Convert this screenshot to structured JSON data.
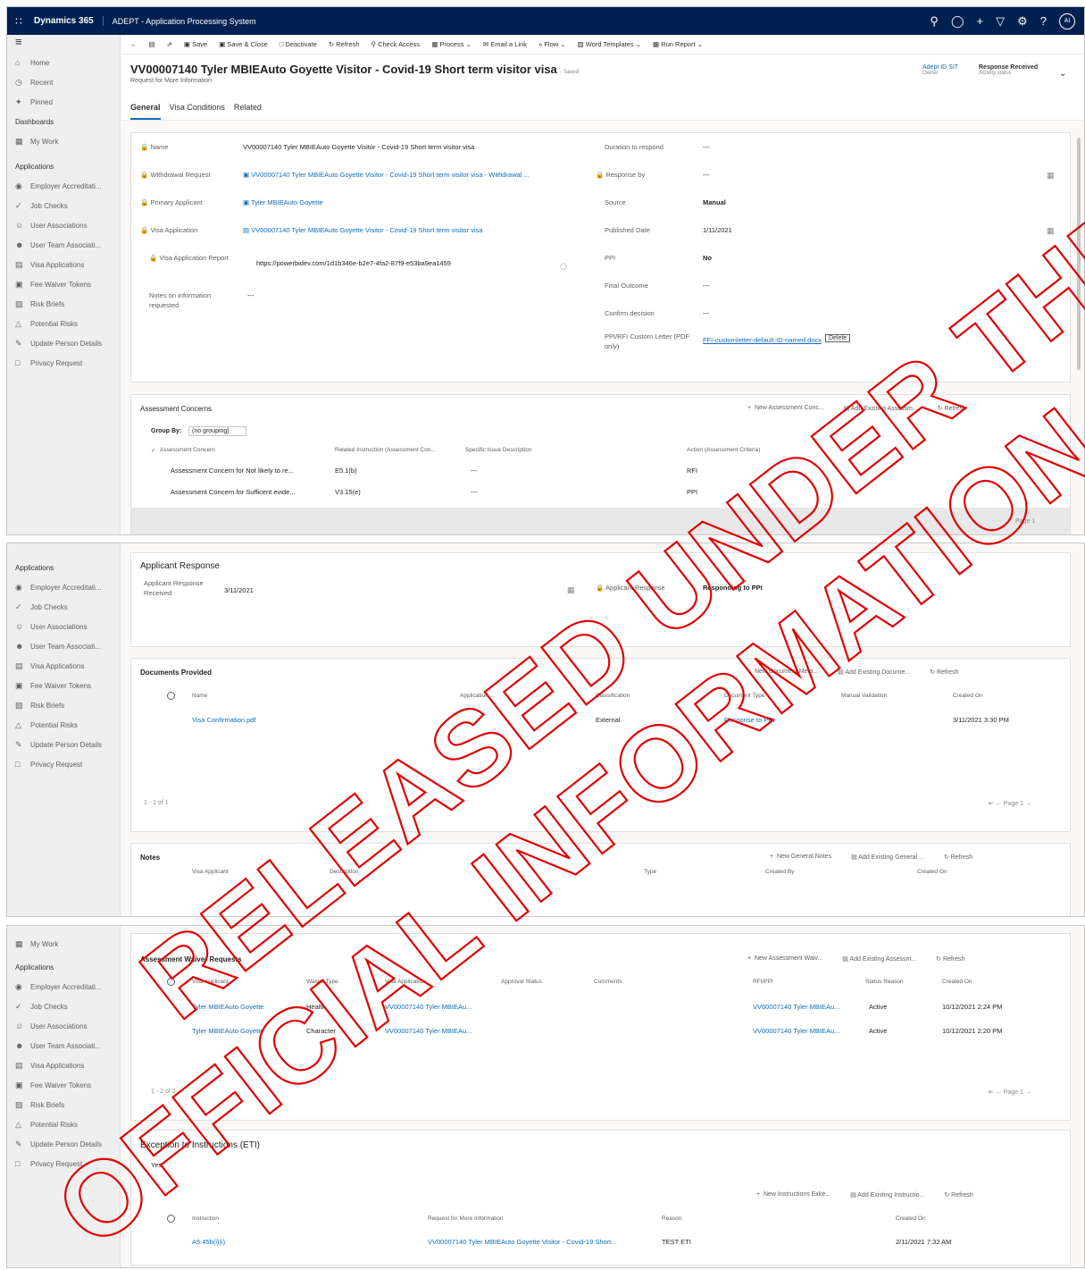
{
  "topbar": {
    "brand": "Dynamics 365",
    "app_title": "ADEPT - Application Processing System",
    "avatar": "AI",
    "icons": [
      "search-icon",
      "lightbulb-icon",
      "plus-icon",
      "filter-icon",
      "gear-icon",
      "help-icon"
    ]
  },
  "sidebar": {
    "home": "Home",
    "recent": "Recent",
    "pinned": "Pinned",
    "dashboards": "Dashboards",
    "my_work": "My Work",
    "applications": "Applications",
    "items": [
      "Employer Accreditati...",
      "Job Checks",
      "User Associations",
      "User Team Associati...",
      "Visa Applications",
      "Fee Waiver Tokens",
      "Risk Briefs",
      "Potential Risks",
      "Update Person Details",
      "Privacy Request"
    ]
  },
  "commands": [
    "Save",
    "Save & Close",
    "Deactivate",
    "Refresh",
    "Check Access",
    "Process",
    "Email a Link",
    "Flow",
    "Word Templates",
    "Run Report"
  ],
  "record": {
    "title": "VV00007140 Tyler MBIEAuto Goyette Visitor - Covid-19 Short term visitor visa",
    "title_suffix": "- Saved",
    "subtitle": "Request for More Information",
    "owner_value": "Adept ID SIT",
    "owner_label": "Owner",
    "status_value": "Response Received",
    "status_label": "Activity status"
  },
  "tabs": [
    "General",
    "Visa Conditions",
    "Related"
  ],
  "fields_left": [
    {
      "label": "Name",
      "value": "VV00007140 Tyler MBIEAuto Goyette Visitor - Covid-19 Short term visitor visa"
    },
    {
      "label": "Withdrawal Request",
      "value": "VV00007140 Tyler MBIEAuto Goyette Visitor - Covid-19 Short term visitor visa - Withdrawal ..."
    },
    {
      "label": "Primary Applicant",
      "value": "Tyler MBIEAuto Goyette"
    },
    {
      "label": "Visa Application",
      "value": "VV00007140 Tyler MBIEAuto Goyette Visitor - Covid-19 Short term visitor visa"
    },
    {
      "label": "Visa Application Report",
      "value": "https://powerbidev.com/1d1b346e-b2e7-4fa2-87f9-e53ba9ea1459"
    },
    {
      "label": "Notes on information requested",
      "value": "---"
    }
  ],
  "fields_right": [
    {
      "label": "Duration to respond",
      "value": "---"
    },
    {
      "label": "Response by",
      "value": "---"
    },
    {
      "label": "Source",
      "value": "Manual"
    },
    {
      "label": "Published Date",
      "value": "1/11/2021"
    },
    {
      "label": "PPI",
      "value": "No"
    },
    {
      "label": "Final Outcome",
      "value": "---"
    },
    {
      "label": "Confirm decision",
      "value": "---"
    },
    {
      "label": "PPI/RFI Custom Letter (PDF only)",
      "value": "FFI-customletter-default-ID-named.docx",
      "button": "Delete"
    }
  ],
  "concerns": {
    "title": "Assessment Concerns",
    "actions": [
      "New Assessment Conc...",
      "Add Existing Assessm...",
      "Refresh"
    ],
    "group_by_label": "Group By:",
    "group_by_value": "(no grouping)",
    "headers": [
      "Assessment Concern",
      "Related Instruction (Assessment Con...",
      "Specific Issue Description",
      "Action (Assessment Criteria)"
    ],
    "rows": [
      [
        "Assessment Concern for Not likely to re...",
        "E5.1(b)",
        "---",
        "RFI"
      ],
      [
        "Assessment Concern for Sufficent evide...",
        "V3.15(e)",
        "---",
        "PPI"
      ]
    ],
    "footer": "Page 1"
  },
  "applicant_response": {
    "title": "Applicant Response",
    "received_label": "Applicant Response Received",
    "received_value": "3/11/2021",
    "response_label": "Applicant Response",
    "response_value": "Responding to PPI"
  },
  "documents": {
    "title": "Documents Provided",
    "actions": [
      "New Document Meta...",
      "Add Existing Docume...",
      "Refresh"
    ],
    "headers": [
      "Name",
      "Application ...",
      "Classification",
      "Document Type",
      "Manual Validation",
      "Created On"
    ],
    "rows": [
      [
        "Visa Confirmation.pdf",
        "",
        "External",
        "Response to PPI",
        "",
        "3/11/2021 3:30 PM"
      ]
    ],
    "count": "1 - 1 of 1",
    "page": "Page 1"
  },
  "notes": {
    "title": "Notes",
    "actions": [
      "New General Notes",
      "Add Existing General ...",
      "Refresh"
    ],
    "headers": [
      "Visa Applicant",
      "Description",
      "Type",
      "Created By",
      "Created On"
    ]
  },
  "waivers": {
    "title": "Assessment Waiver Requests",
    "actions": [
      "New Assessment Waiv...",
      "Add Existing Assessm...",
      "Refresh"
    ],
    "headers": [
      "Visa Applicant",
      "Waiver Type",
      "Visa Application",
      "Approval Status",
      "Comments",
      "RFI/PPI",
      "Status Reason",
      "Created On"
    ],
    "rows": [
      [
        "Tyler MBIEAuto Goyette",
        "Health",
        "VV00007140 Tyler MBIEAu...",
        "",
        "",
        "VV00007140 Tyler MBIEAu...",
        "Active",
        "10/12/2021 2:24 PM"
      ],
      [
        "Tyler MBIEAuto Goyette",
        "Character",
        "VV00007140 Tyler MBIEAu...",
        "",
        "",
        "VV00007140 Tyler MBIEAu...",
        "Active",
        "10/12/2021 2:20 PM"
      ]
    ],
    "count": "1 - 2 of 2",
    "page": "Page 1"
  },
  "eti": {
    "title": "Exception to Instructions (ETI)",
    "sub": "Yes",
    "actions": [
      "New Instructions Exke...",
      "Add Existing Instructio...",
      "Refresh"
    ],
    "headers": [
      "Instruction",
      "Request for More Information",
      "Reason",
      "Created On"
    ],
    "rows": [
      [
        "A5.45b(i)(i)",
        "VV00007140 Tyler MBIEAuto Goyette Visitor - Covid-19 Short...",
        "TEST ETI",
        "2/11/2021 7:32 AM"
      ]
    ]
  },
  "watermark": {
    "line1": "RELEASED UNDER THE",
    "line2": "OFFICIAL INFORMATION ACT"
  }
}
